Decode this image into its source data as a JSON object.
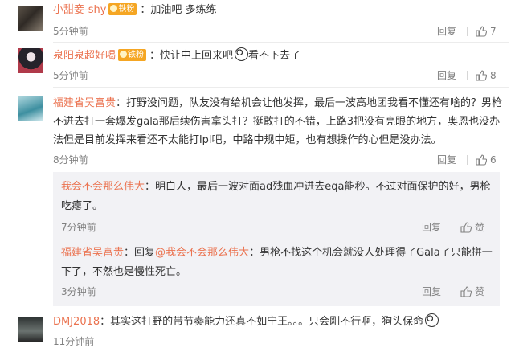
{
  "comments": [
    {
      "username": "小甜妾-shy",
      "badge": "铁粉",
      "text": "加油吧 多练练",
      "time": "5分钟前",
      "reply_label": "回复",
      "likes": "7"
    },
    {
      "username": "泉阳泉超好喝",
      "badge": "铁粉",
      "text": "快让中上回来吧",
      "text_after_emoji": "看不下去了",
      "time": "5分钟前",
      "reply_label": "回复",
      "likes": "8"
    },
    {
      "username": "福建省吴富贵",
      "text_line1": "打野没问题，队友没有给机会让他发挥，最后一波高地团我看不懂还有啥的？男枪",
      "text_line2": "不进去打一套爆发gala那后续伤害拿头打？挺敢打的不错，上路3把没有亮眼的地方，奥恩也没办",
      "text_line3": "法但是目前发挥来看还不太能打lpl吧，中路中规中矩，也有想操作的心但是没办法。",
      "time": "8分钟前",
      "reply_label": "回复",
      "likes": "6"
    }
  ],
  "sub_replies": [
    {
      "username": "我会不会那么伟大",
      "text_line1": "明白人，最后一波对面ad残血冲进去eqa能秒。不过对面保护的好，男枪",
      "text_line2": "吃瘪了。",
      "time": "7分钟前",
      "reply_label": "回复",
      "like_label": "赞"
    },
    {
      "username": "福建省吴富贵",
      "reply_prefix": "回复",
      "mention": "@我会不会那么伟大",
      "text_line1": "男枪不找这个机会就没人处理得了Gala了只能拼一",
      "text_line2": "下了，不然也是慢性死亡。",
      "time": "3分钟前",
      "reply_label": "回复",
      "like_label": "赞"
    }
  ],
  "last_comment": {
    "username": "DMJ2018",
    "text": "其实这打野的带节奏能力还真不如宁王。。。只会刚不行啊，狗头保命",
    "time": "11分钟前"
  }
}
